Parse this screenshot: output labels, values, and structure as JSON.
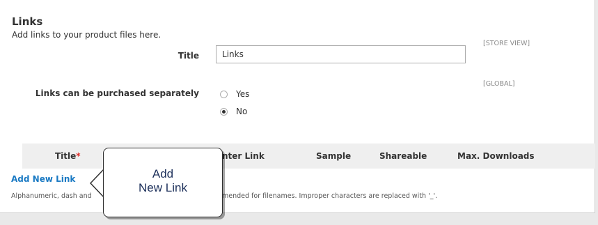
{
  "section": {
    "title": "Links",
    "description": "Add links to your product files here."
  },
  "title_field": {
    "label": "Title",
    "value": "Links",
    "scope": "[STORE VIEW]"
  },
  "purchase_field": {
    "label": "Links can be purchased separately",
    "scope": "[GLOBAL]",
    "options": [
      {
        "label": "Yes",
        "checked": false
      },
      {
        "label": "No",
        "checked": true
      }
    ]
  },
  "grid": {
    "columns": [
      "Title",
      "nter Link",
      "Sample",
      "Shareable",
      "Max. Downloads"
    ],
    "required_mark": "*"
  },
  "add_link_label": "Add New Link",
  "hint": {
    "left": "Alphanumeric, dash and",
    "right": "mended for filenames. Improper characters are replaced with '_'."
  },
  "callout": {
    "line1": "Add",
    "line2": "New Link"
  },
  "colors": {
    "link": "#1979c3",
    "required": "#e02b27",
    "callout_text": "#1c2f5a"
  }
}
